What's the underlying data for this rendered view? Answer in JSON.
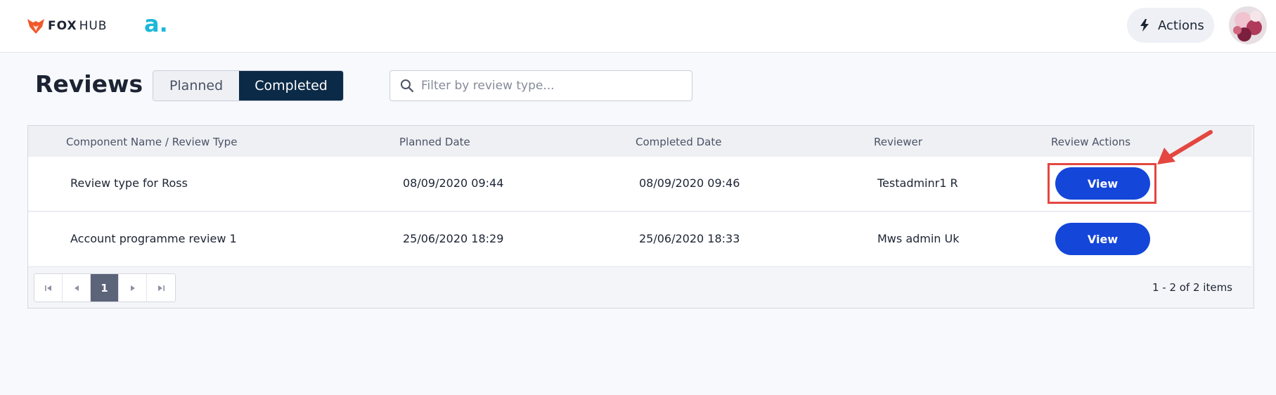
{
  "header": {
    "brand_primary": "FOX",
    "brand_secondary": "HUB",
    "partner_logo": "a.",
    "actions_label": "Actions",
    "actions_icon": "lightning-icon",
    "avatar_icon": "user-avatar"
  },
  "page": {
    "title": "Reviews"
  },
  "tabs": {
    "planned": "Planned",
    "completed": "Completed",
    "active": "Completed"
  },
  "search": {
    "placeholder": "Filter by review type...",
    "value": "",
    "icon": "search-icon"
  },
  "table": {
    "columns": [
      "Component Name / Review Type",
      "Planned Date",
      "Completed Date",
      "Reviewer",
      "Review Actions"
    ],
    "rows": [
      {
        "name": "Review type for Ross",
        "planned": "08/09/2020 09:44",
        "completed": "08/09/2020 09:46",
        "reviewer": "Testadminr1 R",
        "action": "View"
      },
      {
        "name": "Account programme review 1",
        "planned": "25/06/2020 18:29",
        "completed": "25/06/2020 18:33",
        "reviewer": "Mws admin Uk",
        "action": "View"
      }
    ]
  },
  "pagination": {
    "current_page": "1",
    "info": "1 - 2 of 2 items",
    "icons": [
      "first-page-icon",
      "prev-page-icon",
      "next-page-icon",
      "last-page-icon"
    ]
  },
  "colors": {
    "accent": "#1446d9",
    "tab_active_bg": "#0b2a47",
    "brand_orange": "#f0592b",
    "partner_teal": "#1bb8d8",
    "annotation_red": "#e3473f"
  }
}
